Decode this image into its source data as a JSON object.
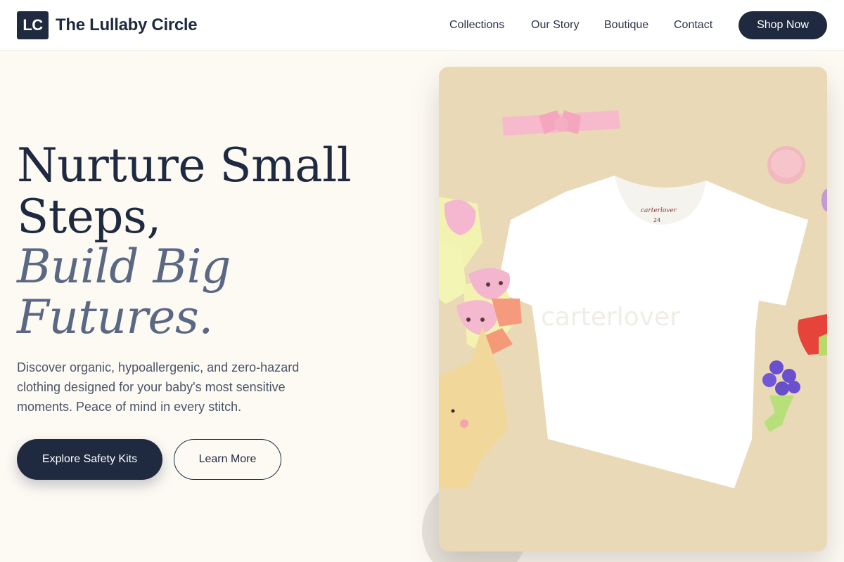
{
  "header": {
    "logo_initials": "LC",
    "brand_name": "The Lullaby Circle",
    "nav": [
      "Collections",
      "Our Story",
      "Boutique",
      "Contact"
    ],
    "cta_label": "Shop Now"
  },
  "hero": {
    "line1": "Nurture Small",
    "line2": "Steps,",
    "line3": "Build Big",
    "line4": "Futures.",
    "description": "Discover organic, hypoallergenic, and zero-hazard clothing designed for your baby's most sensitive moments. Peace of mind in every stitch.",
    "primary_button": "Explore Safety Kits",
    "secondary_button": "Learn More"
  },
  "product_image": {
    "label_brand": "carterlover",
    "label_size": "24",
    "watermark": "carterlover"
  },
  "colors": {
    "navy": "#1f2a40",
    "slate_italic": "#5a6884",
    "background": "#fdfaf4",
    "card_background": "#e9d9b6"
  }
}
